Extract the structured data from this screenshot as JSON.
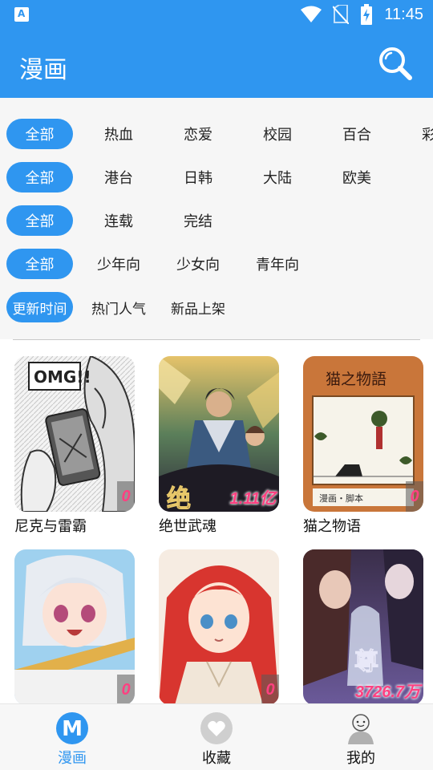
{
  "status_bar": {
    "time": "11:45",
    "icons": [
      "app-notification-icon",
      "wifi-icon",
      "no-sim-icon",
      "battery-charging-icon"
    ]
  },
  "app_bar": {
    "title": "漫画",
    "search_icon": "search-icon"
  },
  "filters": {
    "genre": [
      "全部",
      "热血",
      "恋爱",
      "校园",
      "百合",
      "彩"
    ],
    "region": [
      "全部",
      "港台",
      "日韩",
      "大陆",
      "欧美"
    ],
    "status": [
      "全部",
      "连载",
      "完结"
    ],
    "audience": [
      "全部",
      "少年向",
      "少女向",
      "青年向"
    ],
    "sort": [
      "更新时间",
      "热门人气",
      "新品上架"
    ]
  },
  "comics": [
    {
      "title": "尼克与雷霸",
      "count": "0",
      "cover_text": "OMG!!"
    },
    {
      "title": "绝世武魂",
      "count": "1.11亿"
    },
    {
      "title": "猫之物语",
      "count": "0",
      "cover_text": "猫之物語"
    },
    {
      "title": "",
      "count": "0"
    },
    {
      "title": "",
      "count": "0"
    },
    {
      "title": "",
      "count": "3726.7万"
    }
  ],
  "tabs": [
    {
      "label": "漫画",
      "icon": "manga-m-icon",
      "active": true
    },
    {
      "label": "收藏",
      "icon": "heart-icon",
      "active": false
    },
    {
      "label": "我的",
      "icon": "user-avatar-icon",
      "active": false
    }
  ],
  "colors": {
    "primary": "#2f96f0",
    "badge_text": "#ff4081"
  }
}
